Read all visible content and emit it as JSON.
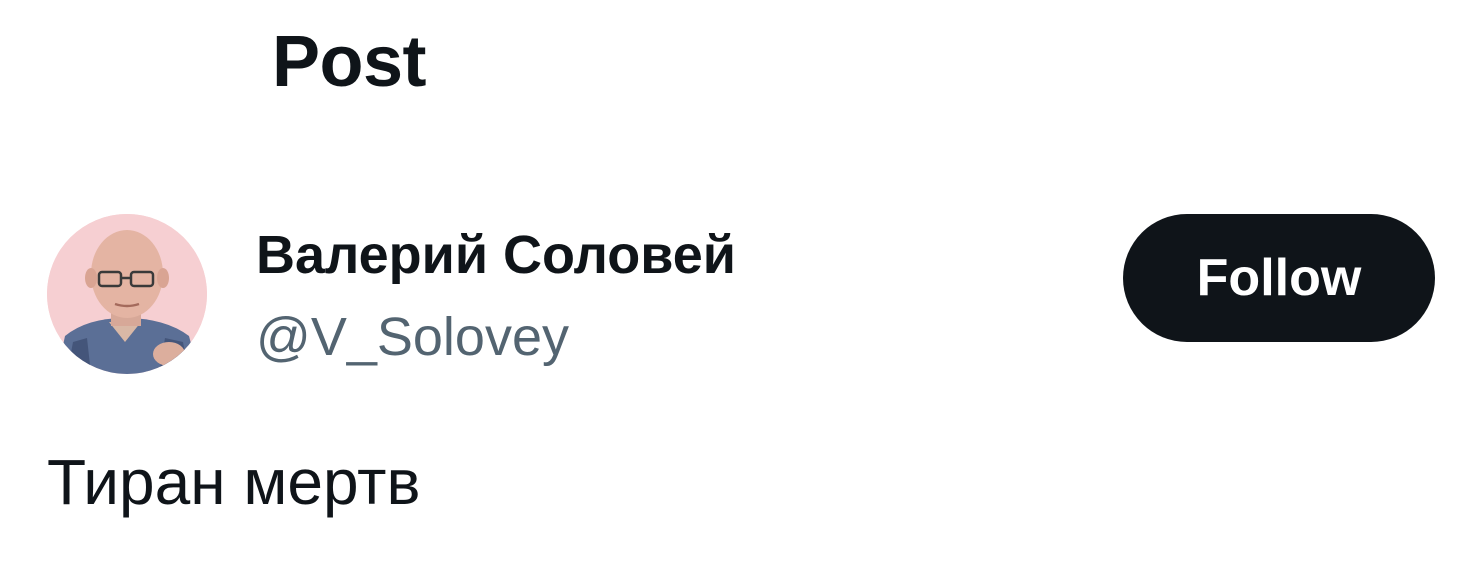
{
  "header": {
    "title": "Post"
  },
  "author": {
    "display_name": "Валерий Соловей",
    "handle": "@V_Solovey",
    "avatar_icon": "person-photo"
  },
  "actions": {
    "follow_label": "Follow"
  },
  "post": {
    "text": "Тиран мертв"
  },
  "colors": {
    "text_primary": "#0f1419",
    "text_secondary": "#536471",
    "button_bg": "#0f1419",
    "button_text": "#ffffff",
    "avatar_bg": "#f6cfd2"
  }
}
